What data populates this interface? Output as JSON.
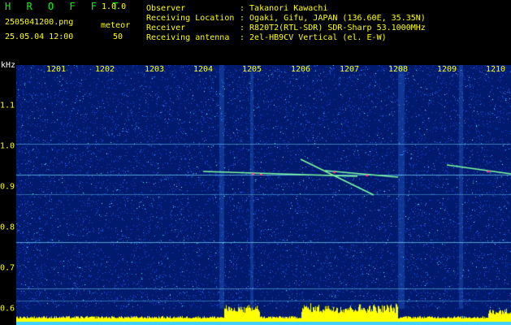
{
  "app": {
    "name": "H R O F F T",
    "version": "1.0.0"
  },
  "file": {
    "name": "2505041200.png",
    "datetime": "25.05.04 12:00"
  },
  "mode": {
    "label": "meteor",
    "value": "50"
  },
  "info": [
    {
      "label": "Observer",
      "value": ": Takanori Kawachi"
    },
    {
      "label": "Receiving Location",
      "value": ": Ogaki, Gifu, JAPAN (136.60E, 35.35N)"
    },
    {
      "label": "Receiver",
      "value": ": R820T2(RTL-SDR) SDR-Sharp 53.1000MHz"
    },
    {
      "label": "Receiving antenna",
      "value": ": 2el-HB9CV Vertical (el. E-W)"
    }
  ],
  "axis": {
    "y_unit": "kHz",
    "x_ticks": [
      "1201",
      "1202",
      "1203",
      "1204",
      "1205",
      "1206",
      "1207",
      "1208",
      "1209",
      "1210"
    ],
    "y_ticks": [
      "1.1",
      "1.0",
      "0.9",
      "0.8",
      "0.7",
      "0.6"
    ]
  },
  "colors": {
    "title": "#00ff00",
    "label": "#ffff00",
    "background": "#001a6e"
  }
}
